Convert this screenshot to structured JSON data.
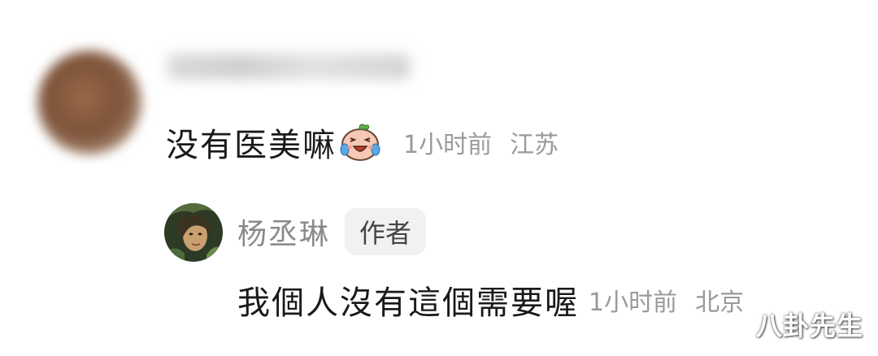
{
  "comment": {
    "text": "没有医美嘛",
    "emoji": "crying-laughing-sticker-icon",
    "time": "1小时前",
    "location": "江苏"
  },
  "reply": {
    "author_name": "杨丞琳",
    "author_badge": "作者",
    "text": "我個人沒有這個需要喔",
    "time": "1小时前",
    "location": "北京"
  },
  "watermark": "八卦先生",
  "colors": {
    "primary_text": "#1a1a1a",
    "meta_text": "#9a9a9a",
    "badge_bg": "#f1f1f1"
  }
}
